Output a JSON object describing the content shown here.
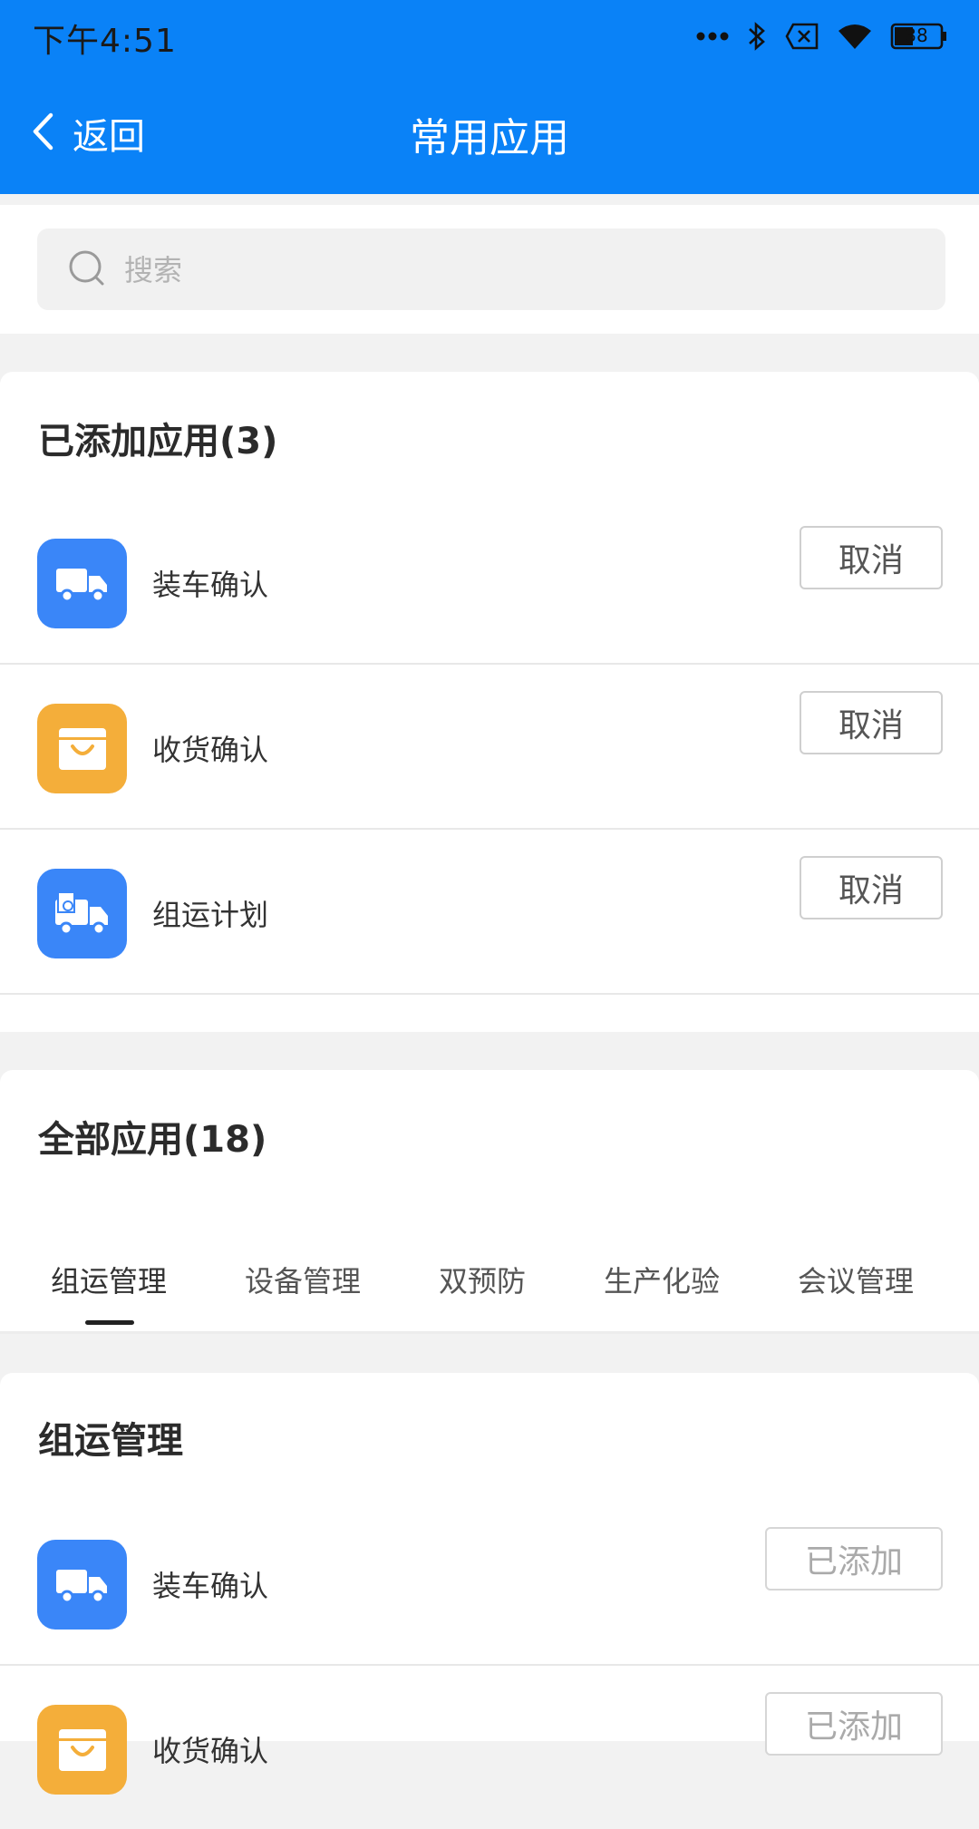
{
  "status": {
    "time": "下午4:51",
    "battery": "38"
  },
  "nav": {
    "back_label": "返回",
    "title": "常用应用"
  },
  "search": {
    "placeholder": "搜索"
  },
  "added_section": {
    "title": "已添加应用(3)",
    "items": [
      {
        "name": "装车确认",
        "icon": "truck-icon",
        "button": "取消"
      },
      {
        "name": "收货确认",
        "icon": "basket-icon",
        "button": "取消"
      },
      {
        "name": "组运计划",
        "icon": "plan-truck-icon",
        "button": "取消"
      }
    ]
  },
  "all_section": {
    "title": "全部应用(18)",
    "tabs": [
      "组运管理",
      "设备管理",
      "双预防",
      "生产化验",
      "会议管理"
    ],
    "active_tab": "组运管理"
  },
  "group_section": {
    "title": "组运管理",
    "items": [
      {
        "name": "装车确认",
        "icon": "truck-icon",
        "button": "已添加"
      },
      {
        "name": "收货确认",
        "icon": "basket-icon",
        "button": "已添加"
      }
    ]
  },
  "colors": {
    "primary": "#0a82f7",
    "icon_blue": "#3a86f8",
    "icon_orange": "#f4ae3a"
  }
}
